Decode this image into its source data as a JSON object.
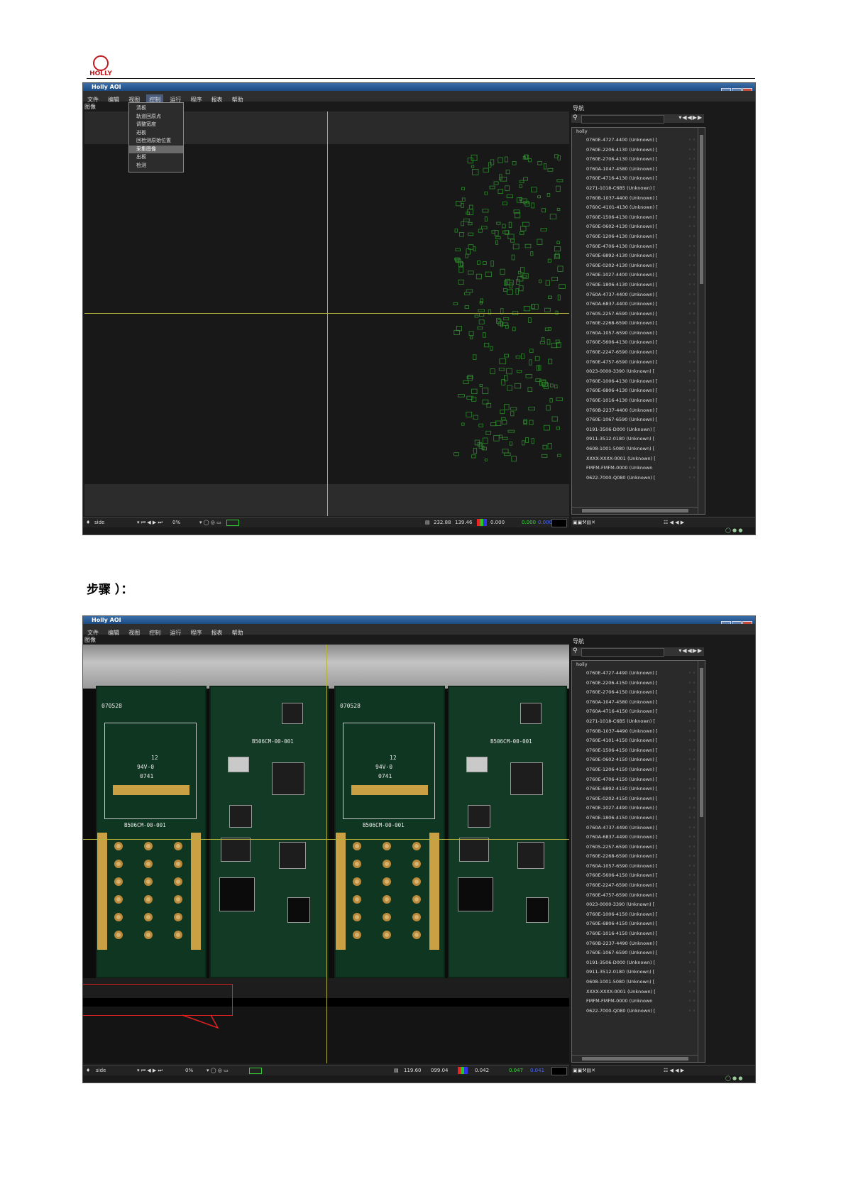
{
  "document": {
    "logo_text": "HOLLY",
    "step_label": "步骤  ）："
  },
  "colors": {
    "accent_title": "#1d4a82",
    "crosshair": "#b4b23a",
    "pcb_green": "#0f3620",
    "callout_red": "#e02020"
  },
  "screenshot1": {
    "window_title": "Holly AOI",
    "menu": [
      "文件",
      "编辑",
      "视图",
      "控制",
      "运行",
      "程序",
      "报表",
      "帮助"
    ],
    "active_menu": "控制",
    "image_panel_title": "图像",
    "nav_panel_title": "导航",
    "dropdown_items": [
      "清板",
      "轨道回原点",
      "调整宽度",
      "进板",
      "回检测原始位置",
      "采集图像",
      "出板",
      "检测"
    ],
    "dropdown_highlighted": "采集图像",
    "tree_root": "holly",
    "tree_rows": [
      "0760E-4727-4400 (Unknown) [",
      "0760E-2206-4130 (Unknown) [",
      "0760E-2706-4130 (Unknown) [",
      "0760A-1047-4580 (Unknown) [",
      "0760E-4716-4130 (Unknown) [",
      "0271-1018-C6B5 (Unknown) [",
      "0760B-1037-4400 (Unknown) [",
      "0760C-4101-4130 (Unknown) [",
      "0760E-1506-4130 (Unknown) [",
      "0760E-0602-4130 (Unknown) [",
      "0760E-1206-4130 (Unknown) [",
      "0760E-4706-4130 (Unknown) [",
      "0760E-6892-4130 (Unknown) [",
      "0760E-0202-4130 (Unknown) [",
      "0760E-1027-4400 (Unknown) [",
      "0760E-1806-4130 (Unknown) [",
      "0760A-4737-4400 (Unknown) [",
      "0760A-6837-4400 (Unknown) [",
      "0760S-2257-6590 (Unknown) [",
      "0760E-2268-6590 (Unknown) [",
      "0760A-1057-6590 (Unknown) [",
      "0760E-5606-4130 (Unknown) [",
      "0760E-2247-6590 (Unknown) [",
      "0760E-4757-6590 (Unknown) [",
      "0023-0000-3390 (Unknown) [",
      "0760E-1006-4130 (Unknown) [",
      "0760E-6806-4130 (Unknown) [",
      "0760E-1016-4130 (Unknown) [",
      "0760B-2237-4400 (Unknown) [",
      "0760E-1067-6590 (Unknown) [",
      "0191-3506-D000 (Unknown) [",
      "0911-3512-0180 (Unknown) [",
      "0608-1001-5080 (Unknown) [",
      "XXXX-XXXX-0001 (Unknown) [",
      "FMFM-FMFM-0000 (Unknown",
      "0622-7000-Q080 (Unknown) ["
    ],
    "status": {
      "layer": "side",
      "zoom": "0%",
      "coords_x": "232.88",
      "coords_y": "139.46",
      "r_value": "0.000",
      "g_value": "0.000",
      "b_value": "0.000"
    }
  },
  "screenshot2": {
    "window_title": "Holly AOI",
    "menu": [
      "文件",
      "编辑",
      "视图",
      "控制",
      "运行",
      "程序",
      "报表",
      "帮助"
    ],
    "image_panel_title": "图像",
    "nav_panel_title": "导航",
    "tree_root": "holly",
    "tree_rows": [
      "0760E-4727-4490 (Unknown) [",
      "0760E-2206-4150 (Unknown) [",
      "0760E-2706-4150 (Unknown) [",
      "0760A-1047-4580 (Unknown) [",
      "0760A-4716-4150 (Unknown) [",
      "0271-1018-C6B5 (Unknown) [",
      "0760B-1037-4490 (Unknown) [",
      "0760E-4101-4150 (Unknown) [",
      "0760E-1506-4150 (Unknown) [",
      "0760E-0602-4150 (Unknown) [",
      "0760E-1206-4150 (Unknown) [",
      "0760E-4706-4150 (Unknown) [",
      "0760E-6892-4150 (Unknown) [",
      "0760E-0202-4150 (Unknown) [",
      "0760E-1027-4490 (Unknown) [",
      "0760E-1806-4150 (Unknown) [",
      "0760A-4737-4490 (Unknown) [",
      "0760A-6837-4490 (Unknown) [",
      "0760S-2257-6590 (Unknown) [",
      "0760E-2268-6590 (Unknown) [",
      "0760A-1057-6590 (Unknown) [",
      "0760E-5606-4150 (Unknown) [",
      "0760E-2247-6590 (Unknown) [",
      "0760E-4757-6590 (Unknown) [",
      "0023-0000-3390 (Unknown) [",
      "0760E-1006-4150 (Unknown) [",
      "0760E-6806-4150 (Unknown) [",
      "0760E-1016-4150 (Unknown) [",
      "0760B-2237-4490 (Unknown) [",
      "0760E-1067-6590 (Unknown) [",
      "0191-3506-D000 (Unknown) [",
      "0911-3512-0180 (Unknown) [",
      "0608-1001-5080 (Unknown) [",
      "XXXX-XXXX-0001 (Unknown) [",
      "FMFM-FMFM-0000 (Unknown",
      "0622-7000-Q080 (Unknown) ["
    ],
    "pcb_labels": {
      "board_id": "070528",
      "model": "B506CM-00-001",
      "marking": "94V-0",
      "lot": "0741",
      "logo_num": "12"
    },
    "status": {
      "layer": "side",
      "zoom": "0%",
      "coords_x": "119.60",
      "coords_y": "099.04",
      "r_value": "0.042",
      "g_value": "0.047",
      "b_value": "0.041"
    }
  }
}
